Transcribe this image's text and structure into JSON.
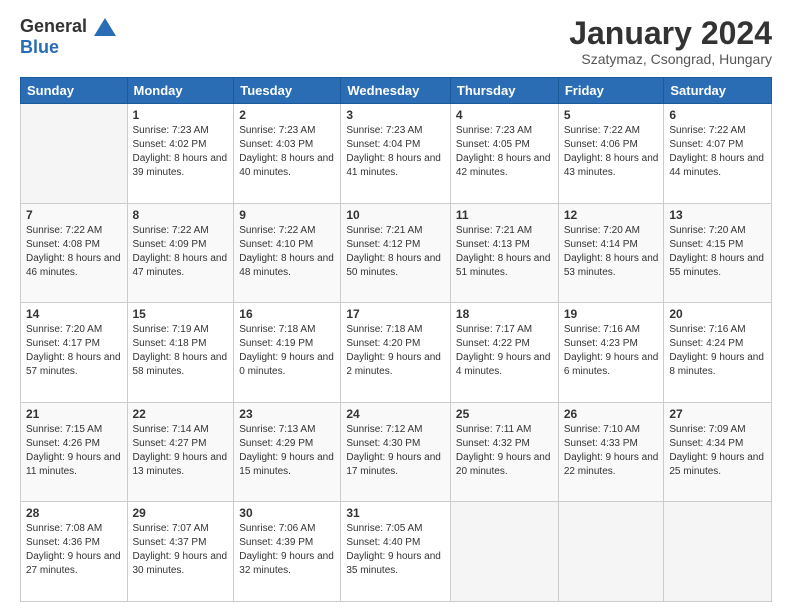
{
  "header": {
    "logo_line1": "General",
    "logo_line2": "Blue",
    "month_title": "January 2024",
    "subtitle": "Szatymaz, Csongrad, Hungary"
  },
  "weekdays": [
    "Sunday",
    "Monday",
    "Tuesday",
    "Wednesday",
    "Thursday",
    "Friday",
    "Saturday"
  ],
  "weeks": [
    [
      {
        "day": "",
        "sunrise": "",
        "sunset": "",
        "daylight": ""
      },
      {
        "day": "1",
        "sunrise": "Sunrise: 7:23 AM",
        "sunset": "Sunset: 4:02 PM",
        "daylight": "Daylight: 8 hours and 39 minutes."
      },
      {
        "day": "2",
        "sunrise": "Sunrise: 7:23 AM",
        "sunset": "Sunset: 4:03 PM",
        "daylight": "Daylight: 8 hours and 40 minutes."
      },
      {
        "day": "3",
        "sunrise": "Sunrise: 7:23 AM",
        "sunset": "Sunset: 4:04 PM",
        "daylight": "Daylight: 8 hours and 41 minutes."
      },
      {
        "day": "4",
        "sunrise": "Sunrise: 7:23 AM",
        "sunset": "Sunset: 4:05 PM",
        "daylight": "Daylight: 8 hours and 42 minutes."
      },
      {
        "day": "5",
        "sunrise": "Sunrise: 7:22 AM",
        "sunset": "Sunset: 4:06 PM",
        "daylight": "Daylight: 8 hours and 43 minutes."
      },
      {
        "day": "6",
        "sunrise": "Sunrise: 7:22 AM",
        "sunset": "Sunset: 4:07 PM",
        "daylight": "Daylight: 8 hours and 44 minutes."
      }
    ],
    [
      {
        "day": "7",
        "sunrise": "Sunrise: 7:22 AM",
        "sunset": "Sunset: 4:08 PM",
        "daylight": "Daylight: 8 hours and 46 minutes."
      },
      {
        "day": "8",
        "sunrise": "Sunrise: 7:22 AM",
        "sunset": "Sunset: 4:09 PM",
        "daylight": "Daylight: 8 hours and 47 minutes."
      },
      {
        "day": "9",
        "sunrise": "Sunrise: 7:22 AM",
        "sunset": "Sunset: 4:10 PM",
        "daylight": "Daylight: 8 hours and 48 minutes."
      },
      {
        "day": "10",
        "sunrise": "Sunrise: 7:21 AM",
        "sunset": "Sunset: 4:12 PM",
        "daylight": "Daylight: 8 hours and 50 minutes."
      },
      {
        "day": "11",
        "sunrise": "Sunrise: 7:21 AM",
        "sunset": "Sunset: 4:13 PM",
        "daylight": "Daylight: 8 hours and 51 minutes."
      },
      {
        "day": "12",
        "sunrise": "Sunrise: 7:20 AM",
        "sunset": "Sunset: 4:14 PM",
        "daylight": "Daylight: 8 hours and 53 minutes."
      },
      {
        "day": "13",
        "sunrise": "Sunrise: 7:20 AM",
        "sunset": "Sunset: 4:15 PM",
        "daylight": "Daylight: 8 hours and 55 minutes."
      }
    ],
    [
      {
        "day": "14",
        "sunrise": "Sunrise: 7:20 AM",
        "sunset": "Sunset: 4:17 PM",
        "daylight": "Daylight: 8 hours and 57 minutes."
      },
      {
        "day": "15",
        "sunrise": "Sunrise: 7:19 AM",
        "sunset": "Sunset: 4:18 PM",
        "daylight": "Daylight: 8 hours and 58 minutes."
      },
      {
        "day": "16",
        "sunrise": "Sunrise: 7:18 AM",
        "sunset": "Sunset: 4:19 PM",
        "daylight": "Daylight: 9 hours and 0 minutes."
      },
      {
        "day": "17",
        "sunrise": "Sunrise: 7:18 AM",
        "sunset": "Sunset: 4:20 PM",
        "daylight": "Daylight: 9 hours and 2 minutes."
      },
      {
        "day": "18",
        "sunrise": "Sunrise: 7:17 AM",
        "sunset": "Sunset: 4:22 PM",
        "daylight": "Daylight: 9 hours and 4 minutes."
      },
      {
        "day": "19",
        "sunrise": "Sunrise: 7:16 AM",
        "sunset": "Sunset: 4:23 PM",
        "daylight": "Daylight: 9 hours and 6 minutes."
      },
      {
        "day": "20",
        "sunrise": "Sunrise: 7:16 AM",
        "sunset": "Sunset: 4:24 PM",
        "daylight": "Daylight: 9 hours and 8 minutes."
      }
    ],
    [
      {
        "day": "21",
        "sunrise": "Sunrise: 7:15 AM",
        "sunset": "Sunset: 4:26 PM",
        "daylight": "Daylight: 9 hours and 11 minutes."
      },
      {
        "day": "22",
        "sunrise": "Sunrise: 7:14 AM",
        "sunset": "Sunset: 4:27 PM",
        "daylight": "Daylight: 9 hours and 13 minutes."
      },
      {
        "day": "23",
        "sunrise": "Sunrise: 7:13 AM",
        "sunset": "Sunset: 4:29 PM",
        "daylight": "Daylight: 9 hours and 15 minutes."
      },
      {
        "day": "24",
        "sunrise": "Sunrise: 7:12 AM",
        "sunset": "Sunset: 4:30 PM",
        "daylight": "Daylight: 9 hours and 17 minutes."
      },
      {
        "day": "25",
        "sunrise": "Sunrise: 7:11 AM",
        "sunset": "Sunset: 4:32 PM",
        "daylight": "Daylight: 9 hours and 20 minutes."
      },
      {
        "day": "26",
        "sunrise": "Sunrise: 7:10 AM",
        "sunset": "Sunset: 4:33 PM",
        "daylight": "Daylight: 9 hours and 22 minutes."
      },
      {
        "day": "27",
        "sunrise": "Sunrise: 7:09 AM",
        "sunset": "Sunset: 4:34 PM",
        "daylight": "Daylight: 9 hours and 25 minutes."
      }
    ],
    [
      {
        "day": "28",
        "sunrise": "Sunrise: 7:08 AM",
        "sunset": "Sunset: 4:36 PM",
        "daylight": "Daylight: 9 hours and 27 minutes."
      },
      {
        "day": "29",
        "sunrise": "Sunrise: 7:07 AM",
        "sunset": "Sunset: 4:37 PM",
        "daylight": "Daylight: 9 hours and 30 minutes."
      },
      {
        "day": "30",
        "sunrise": "Sunrise: 7:06 AM",
        "sunset": "Sunset: 4:39 PM",
        "daylight": "Daylight: 9 hours and 32 minutes."
      },
      {
        "day": "31",
        "sunrise": "Sunrise: 7:05 AM",
        "sunset": "Sunset: 4:40 PM",
        "daylight": "Daylight: 9 hours and 35 minutes."
      },
      {
        "day": "",
        "sunrise": "",
        "sunset": "",
        "daylight": ""
      },
      {
        "day": "",
        "sunrise": "",
        "sunset": "",
        "daylight": ""
      },
      {
        "day": "",
        "sunrise": "",
        "sunset": "",
        "daylight": ""
      }
    ]
  ]
}
